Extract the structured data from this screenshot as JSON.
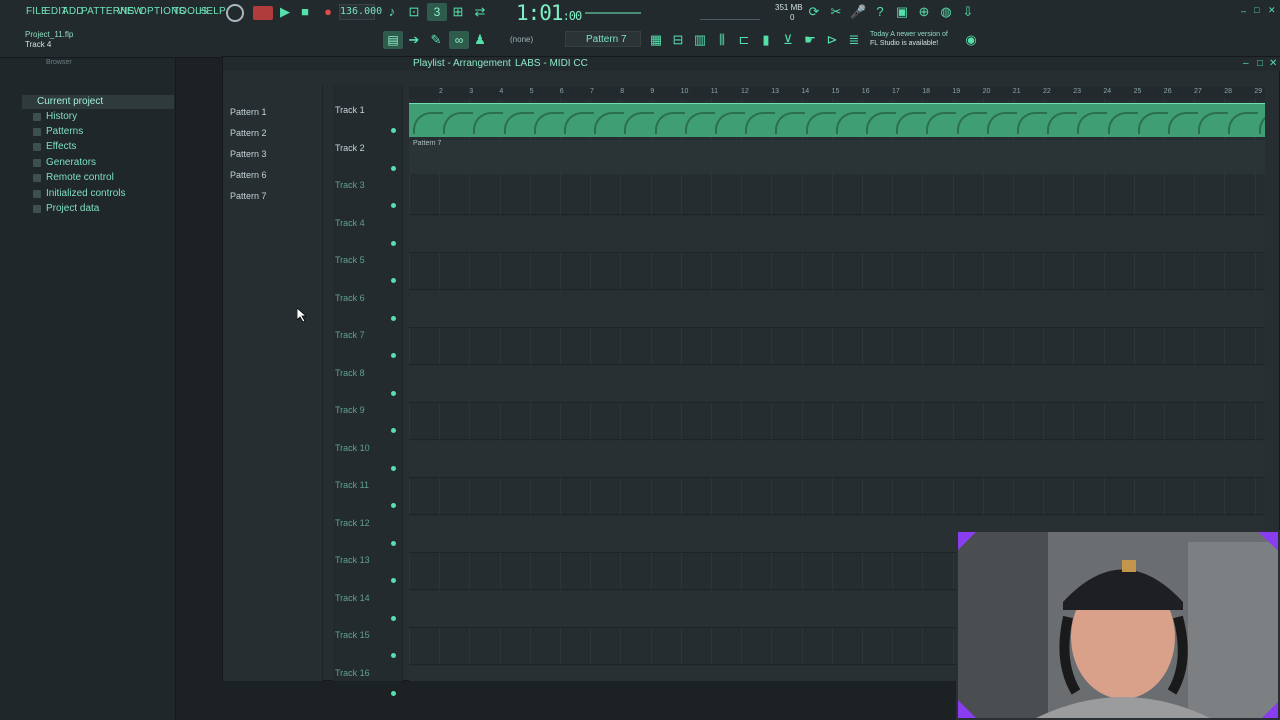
{
  "menu": [
    "FILE",
    "EDIT",
    "ADD",
    "PATTERNS",
    "VIEW",
    "OPTIONS",
    "TOOLS",
    "HELP"
  ],
  "transport": {
    "tempo": "136.000",
    "time_main": "1:01",
    "time_sub": ":00",
    "memory": "351 MB",
    "cpu": "0"
  },
  "project": {
    "filename": "Project_11.flp",
    "track_hint": "Track 4"
  },
  "pattern_selector": {
    "none_label": "(none)",
    "pattern_label": "Pattern 7"
  },
  "news": {
    "line1": "Today  A newer version of",
    "line2": "FL Studio is available!"
  },
  "browser": {
    "title": "Browser",
    "root": "Current project",
    "items": [
      "History",
      "Patterns",
      "Effects",
      "Generators",
      "Remote control",
      "Initialized controls",
      "Project data"
    ]
  },
  "playlist": {
    "title": "Playlist - Arrangement",
    "breadcrumb": "LABS - MIDI CC",
    "patterns": [
      "Pattern 1",
      "Pattern 2",
      "Pattern 3",
      "Pattern 6",
      "Pattern 7"
    ],
    "tracks": [
      "Track 1",
      "Track 2",
      "Track 3",
      "Track 4",
      "Track 5",
      "Track 6",
      "Track 7",
      "Track 8",
      "Track 9",
      "Track 10",
      "Track 11",
      "Track 12",
      "Track 13",
      "Track 14",
      "Track 15",
      "Track 16"
    ],
    "bars": [
      "2",
      "3",
      "4",
      "5",
      "6",
      "7",
      "8",
      "9",
      "10",
      "11",
      "12",
      "13",
      "14",
      "15",
      "16",
      "17",
      "18",
      "19",
      "20",
      "21",
      "22",
      "23",
      "24",
      "25",
      "26",
      "27",
      "28",
      "29"
    ],
    "clip2_label": "Pattern 7"
  },
  "colors": {
    "accent": "#57e0ab",
    "clip": "#3f9e73",
    "bg": "#1c2124"
  }
}
